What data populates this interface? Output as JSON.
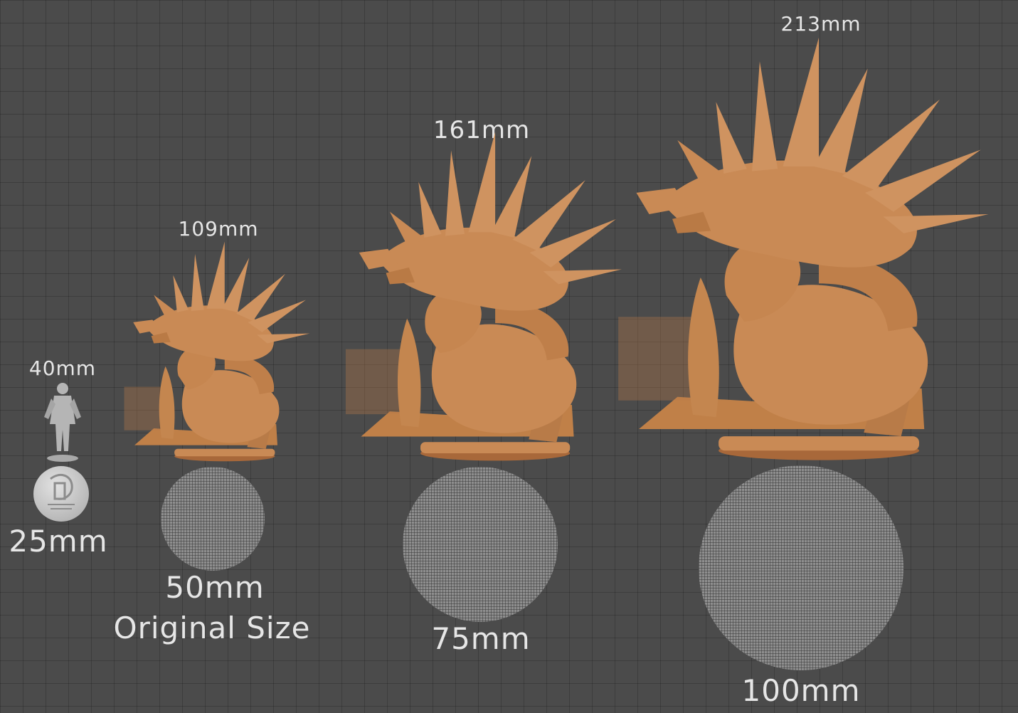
{
  "figures": [
    {
      "height_label": "40mm",
      "base_label": "25mm"
    },
    {
      "height_label": "109mm",
      "base_label": "50mm",
      "note": "Original Size"
    },
    {
      "height_label": "161mm",
      "base_label": "75mm"
    },
    {
      "height_label": "213mm",
      "base_label": "100mm"
    }
  ],
  "colors": {
    "background": "#4b4b4b",
    "model": "#c98a55",
    "reference_figure": "#b5b5b5",
    "label_text": "#e6e6e6"
  }
}
